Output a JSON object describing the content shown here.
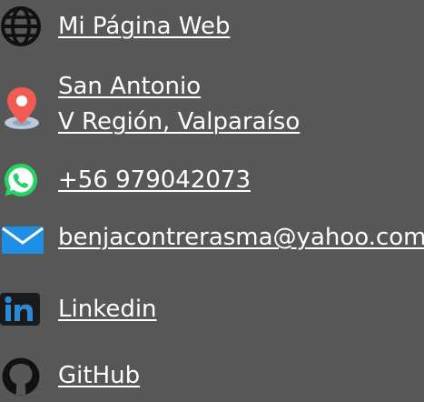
{
  "contacts": {
    "website": {
      "label": "Mi Página Web",
      "icon": "globe-icon"
    },
    "location": {
      "line1": "San Antonio",
      "line2": "V Región, Valparaíso",
      "icon": "map-pin-icon"
    },
    "phone": {
      "label": "+56 979042073",
      "icon": "whatsapp-icon"
    },
    "email": {
      "label": "benjacontrerasma@yahoo.com",
      "icon": "mail-icon"
    },
    "linkedin": {
      "label": "Linkedin",
      "icon": "linkedin-icon"
    },
    "github": {
      "label": "GitHub",
      "icon": "github-icon"
    }
  },
  "colors": {
    "background": "#575757",
    "text": "#ffffff",
    "pin_red": "#f25b52",
    "whatsapp_green": "#25d366",
    "mail_blue": "#1f8fe6",
    "linkedin_blue": "#0a66c2"
  }
}
